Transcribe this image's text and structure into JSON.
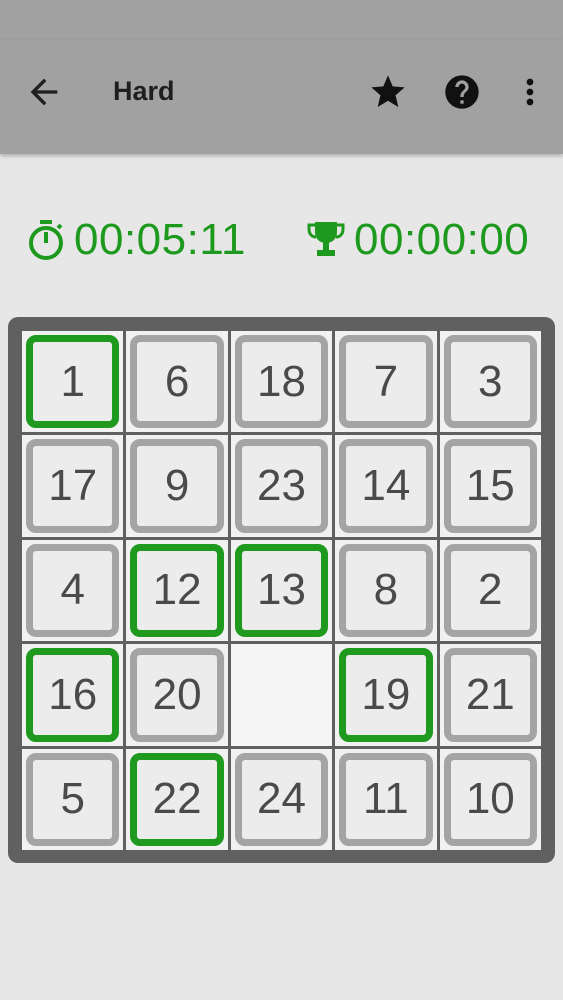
{
  "app_bar": {
    "title": "Hard",
    "back_icon": "arrow-back-icon",
    "actions": [
      "star-icon",
      "help-circle-icon",
      "more-vert-icon"
    ]
  },
  "timers": {
    "elapsed": "00:05:11",
    "best": "00:00:00",
    "elapsed_icon": "stopwatch-icon",
    "best_icon": "trophy-icon",
    "color": "#1d9a1d"
  },
  "board": {
    "columns": 5,
    "rows": 5,
    "tiles": [
      {
        "label": "1",
        "correct": true
      },
      {
        "label": "6",
        "correct": false
      },
      {
        "label": "18",
        "correct": false
      },
      {
        "label": "7",
        "correct": false
      },
      {
        "label": "3",
        "correct": false
      },
      {
        "label": "17",
        "correct": false
      },
      {
        "label": "9",
        "correct": false
      },
      {
        "label": "23",
        "correct": false
      },
      {
        "label": "14",
        "correct": false
      },
      {
        "label": "15",
        "correct": false
      },
      {
        "label": "4",
        "correct": false
      },
      {
        "label": "12",
        "correct": true
      },
      {
        "label": "13",
        "correct": true
      },
      {
        "label": "8",
        "correct": false
      },
      {
        "label": "2",
        "correct": false
      },
      {
        "label": "16",
        "correct": true
      },
      {
        "label": "20",
        "correct": false
      },
      {
        "label": "",
        "empty": true
      },
      {
        "label": "19",
        "correct": true
      },
      {
        "label": "21",
        "correct": false
      },
      {
        "label": "5",
        "correct": false
      },
      {
        "label": "22",
        "correct": true
      },
      {
        "label": "24",
        "correct": false
      },
      {
        "label": "11",
        "correct": false
      },
      {
        "label": "10",
        "correct": false
      }
    ],
    "correct_color": "#1f9a1f",
    "tile_border_color": "#a4a4a4",
    "board_color": "#606060"
  }
}
